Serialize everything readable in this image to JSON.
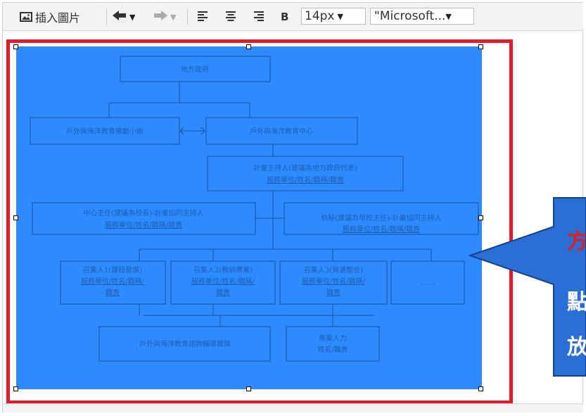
{
  "toolbar": {
    "insert_image_label": "插入圖片",
    "font_size": "14px",
    "font_family": "\"Microsoft...",
    "bold_label": "B"
  },
  "orgchart": {
    "local_gov": "地方政府",
    "promo_group": "戶外與海洋教育推動小組",
    "center": "戶外與海洋教育中心",
    "host_title": "計畫主持人(建議為地方政府代表)",
    "host_sub": "服務單位/姓名/職稱/職責",
    "director_title": "中心主任(建議為校長)-計畫協同主持人",
    "director_sub": "服務單位/姓名/職稱/職責",
    "secretary_title": "執秘(建議為學校主任)-計畫協同主持人",
    "secretary_sub": "服務單位/姓名/職稱/職責",
    "convener1_title": "召集人1(課程發展)",
    "convener1_sub": "服務單位/姓名/職稱/",
    "convener1_sub2": "職責",
    "convener2_title": "召集人2(教師專業)",
    "convener2_sub": "服務單位/姓名/職稱/",
    "convener2_sub2": "職責",
    "convener3_title": "召集人3(資源整合)",
    "convener3_sub": "服務單位/姓名/職稱/",
    "convener3_sub2": "職責",
    "more": "……",
    "team": "戶外與海洋教育諮詢輔導團隊",
    "staff_title": "專案人力",
    "staff_sub": "姓名/職責"
  },
  "callout": {
    "line1": "方",
    "line2": "點",
    "line3": "放"
  },
  "colors": {
    "selection_blue": "#2e8bff",
    "frame_red": "#e21c2a",
    "callout_blue": "#2a6fd6",
    "callout_red_text": "#e0201e"
  }
}
